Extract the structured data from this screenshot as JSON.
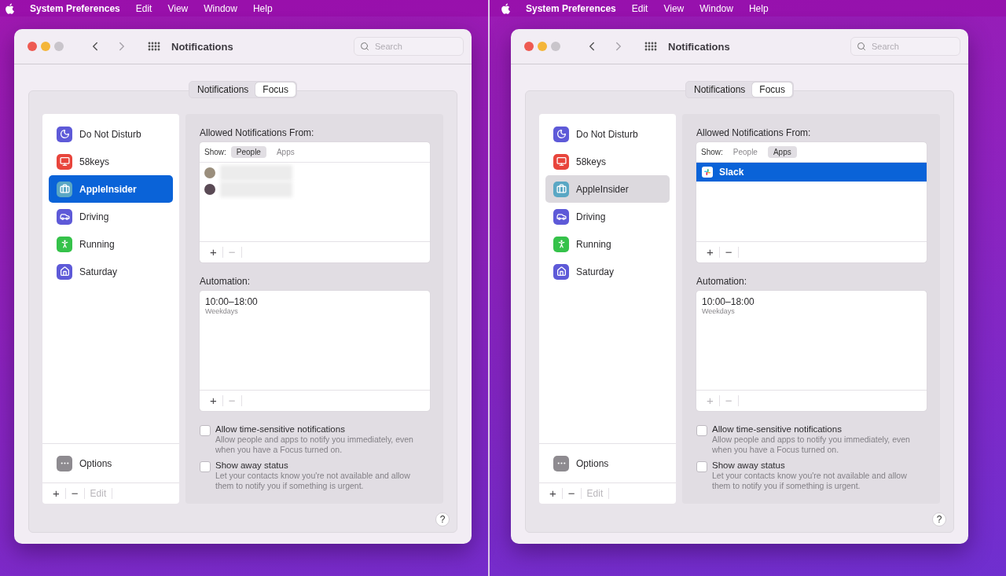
{
  "screens": [
    {
      "menu_bar": {
        "items": [
          "System Preferences",
          "Edit",
          "View",
          "Window",
          "Help"
        ]
      },
      "window": {
        "title": "Notifications",
        "search": {
          "placeholder": "Search"
        },
        "tabs": [
          {
            "label": "Notifications",
            "selected": false
          },
          {
            "label": "Focus",
            "selected": true
          }
        ],
        "sidebar": {
          "focused": true,
          "items": [
            {
              "label": "Do Not Disturb",
              "kind": "moon",
              "color": "#5e5ad8",
              "selected": false
            },
            {
              "label": "58keys",
              "kind": "display",
              "color": "#e8453c",
              "selected": false
            },
            {
              "label": "AppleInsider",
              "kind": "briefcase",
              "color": "#5aa7c4",
              "selected": true
            },
            {
              "label": "Driving",
              "kind": "car",
              "color": "#5e5ad8",
              "selected": false
            },
            {
              "label": "Running",
              "kind": "runner",
              "color": "#35c24a",
              "selected": false
            },
            {
              "label": "Saturday",
              "kind": "house",
              "color": "#5e5ad8",
              "selected": false
            }
          ],
          "options": {
            "label": "Options"
          },
          "footer": [
            {
              "label": "+",
              "disabled": false
            },
            {
              "label": "−",
              "disabled": false
            },
            {
              "label": "Edit",
              "disabled": true
            }
          ]
        },
        "allowed": {
          "title": "Allowed Notifications From:",
          "show_label": "Show:",
          "filters": [
            {
              "label": "People",
              "selected": true
            },
            {
              "label": "Apps",
              "selected": false
            }
          ],
          "entries": [
            {
              "kind": "person"
            },
            {
              "kind": "person"
            }
          ],
          "footer": [
            {
              "label": "+",
              "disabled": false
            },
            {
              "label": "−",
              "disabled": true
            }
          ]
        },
        "automation": {
          "title": "Automation:",
          "entries": [
            {
              "time": "10:00–18:00",
              "days": "Weekdays"
            }
          ],
          "footer": [
            {
              "label": "+",
              "disabled": false
            },
            {
              "label": "−",
              "disabled": true
            }
          ]
        },
        "settings": [
          {
            "label": "Allow time-sensitive notifications",
            "description": "Allow people and apps to notify you immediately, even when you have a Focus turned on.",
            "checked": false
          },
          {
            "label": "Show away status",
            "description": "Let your contacts know you're not available and allow them to notify you if something is urgent.",
            "checked": false
          }
        ],
        "help": "?"
      }
    },
    {
      "menu_bar": {
        "items": [
          "System Preferences",
          "Edit",
          "View",
          "Window",
          "Help"
        ]
      },
      "window": {
        "title": "Notifications",
        "search": {
          "placeholder": "Search"
        },
        "tabs": [
          {
            "label": "Notifications",
            "selected": false
          },
          {
            "label": "Focus",
            "selected": true
          }
        ],
        "sidebar": {
          "focused": false,
          "items": [
            {
              "label": "Do Not Disturb",
              "kind": "moon",
              "color": "#5e5ad8",
              "selected": false
            },
            {
              "label": "58keys",
              "kind": "display",
              "color": "#e8453c",
              "selected": false
            },
            {
              "label": "AppleInsider",
              "kind": "briefcase",
              "color": "#5aa7c4",
              "selected": true
            },
            {
              "label": "Driving",
              "kind": "car",
              "color": "#5e5ad8",
              "selected": false
            },
            {
              "label": "Running",
              "kind": "runner",
              "color": "#35c24a",
              "selected": false
            },
            {
              "label": "Saturday",
              "kind": "house",
              "color": "#5e5ad8",
              "selected": false
            }
          ],
          "options": {
            "label": "Options"
          },
          "footer": [
            {
              "label": "+",
              "disabled": false
            },
            {
              "label": "−",
              "disabled": false
            },
            {
              "label": "Edit",
              "disabled": true
            }
          ]
        },
        "allowed": {
          "title": "Allowed Notifications From:",
          "show_label": "Show:",
          "filters": [
            {
              "label": "People",
              "selected": false
            },
            {
              "label": "Apps",
              "selected": true
            }
          ],
          "entries": [
            {
              "kind": "app",
              "label": "Slack",
              "selected": true
            }
          ],
          "footer": [
            {
              "label": "+",
              "disabled": false
            },
            {
              "label": "−",
              "disabled": false
            }
          ]
        },
        "automation": {
          "title": "Automation:",
          "entries": [
            {
              "time": "10:00–18:00",
              "days": "Weekdays"
            }
          ],
          "footer": [
            {
              "label": "+",
              "disabled": true
            },
            {
              "label": "−",
              "disabled": true
            }
          ]
        },
        "settings": [
          {
            "label": "Allow time-sensitive notifications",
            "description": "Allow people and apps to notify you immediately, even when you have a Focus turned on.",
            "checked": false
          },
          {
            "label": "Show away status",
            "description": "Let your contacts know you're not available and allow them to notify you if something is urgent.",
            "checked": false
          }
        ],
        "help": "?"
      }
    }
  ]
}
